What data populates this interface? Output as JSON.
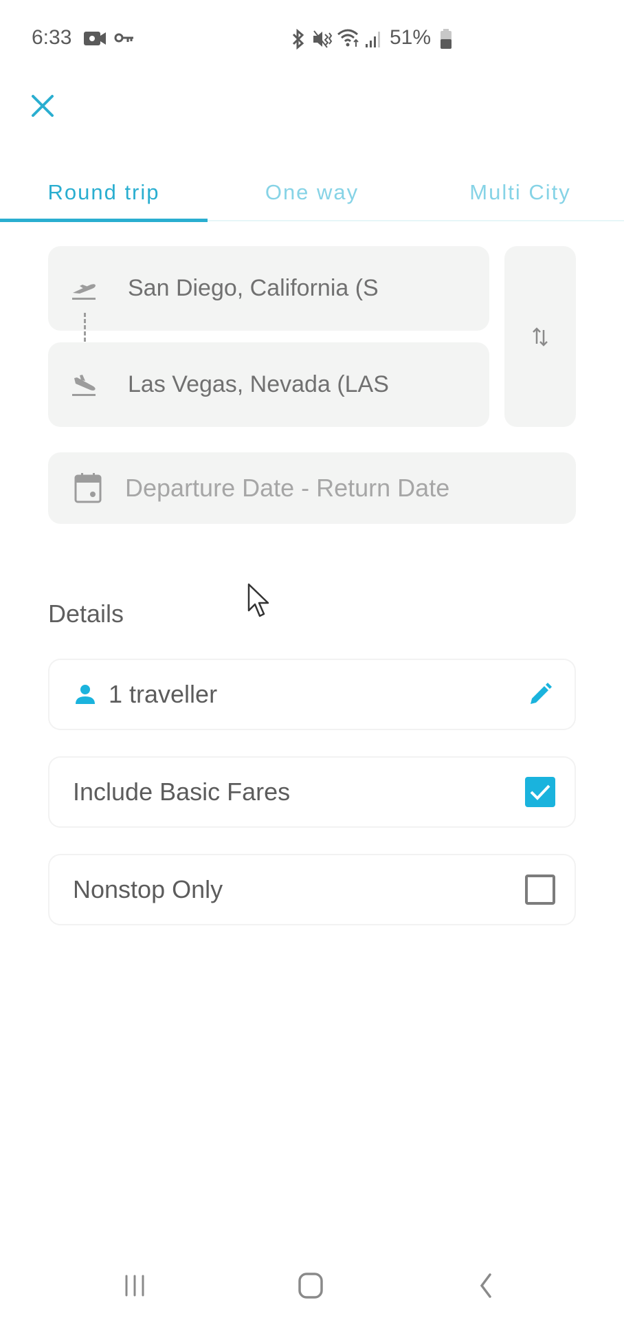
{
  "status_bar": {
    "time": "6:33",
    "left_icons": [
      "video-camera-icon",
      "vpn-key-icon"
    ],
    "right_icons": [
      "bluetooth-icon",
      "vibrate-mute-icon",
      "wifi-icon",
      "signal-icon"
    ],
    "battery_percent": "51%"
  },
  "header": {
    "close_icon": "close-icon"
  },
  "tabs": [
    {
      "label": "Round trip",
      "active": true
    },
    {
      "label": "One way",
      "active": false
    },
    {
      "label": "Multi City",
      "active": false
    }
  ],
  "search": {
    "origin": "San Diego, California (SAN)",
    "origin_display": "San Diego, California (S",
    "destination": "Las Vegas, Nevada (LAS)",
    "destination_display": "Las Vegas, Nevada (LAS",
    "swap_icon": "swap-vertical-icon",
    "date_placeholder": "Departure Date - Return Date"
  },
  "details": {
    "title": "Details",
    "travellers_label": "1 traveller",
    "options": [
      {
        "label": "Include Basic Fares",
        "checked": true
      },
      {
        "label": "Nonstop Only",
        "checked": false
      }
    ]
  },
  "colors": {
    "accent": "#2aaed0",
    "checkbox": "#1ab3dd",
    "field_bg": "#f3f4f3"
  },
  "nav_bar": {
    "buttons": [
      "recent-apps",
      "home",
      "back"
    ]
  }
}
